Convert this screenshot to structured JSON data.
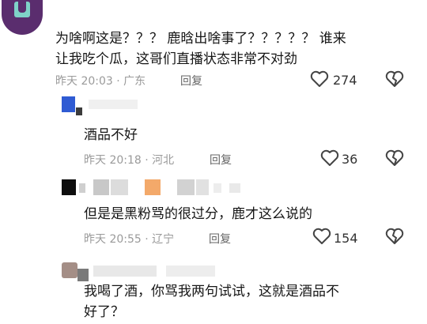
{
  "comments": [
    {
      "text_line1": "为啥啊这是？？？ 鹿晗出啥事了？？？？？ 谁来",
      "text_line2": "让我吃个瓜，这哥们直播状态非常不对劲",
      "time": "昨天 20:03 · 广东",
      "reply": "回复",
      "likes": "274"
    },
    {
      "text": "酒品不好",
      "time": "昨天 20:18 · 河北",
      "reply": "回复",
      "likes": "36"
    },
    {
      "text": "但是是黑粉骂的很过分，鹿才这么说的",
      "time": "昨天 20:55 · 辽宁",
      "reply": "回复",
      "likes": "154"
    },
    {
      "text_line1": "我喝了酒，你骂我两句试试，这就是酒品不",
      "text_line2": "好了？"
    }
  ],
  "colors": {
    "avatar_purple": "#5a2d6e",
    "avatar_teal": "#7fd2c8",
    "blue_avatar": "#2f5bd3",
    "orange_block": "#f3a96a"
  },
  "icons": {
    "like": "heart-outline-icon",
    "dislike": "broken-heart-icon"
  }
}
